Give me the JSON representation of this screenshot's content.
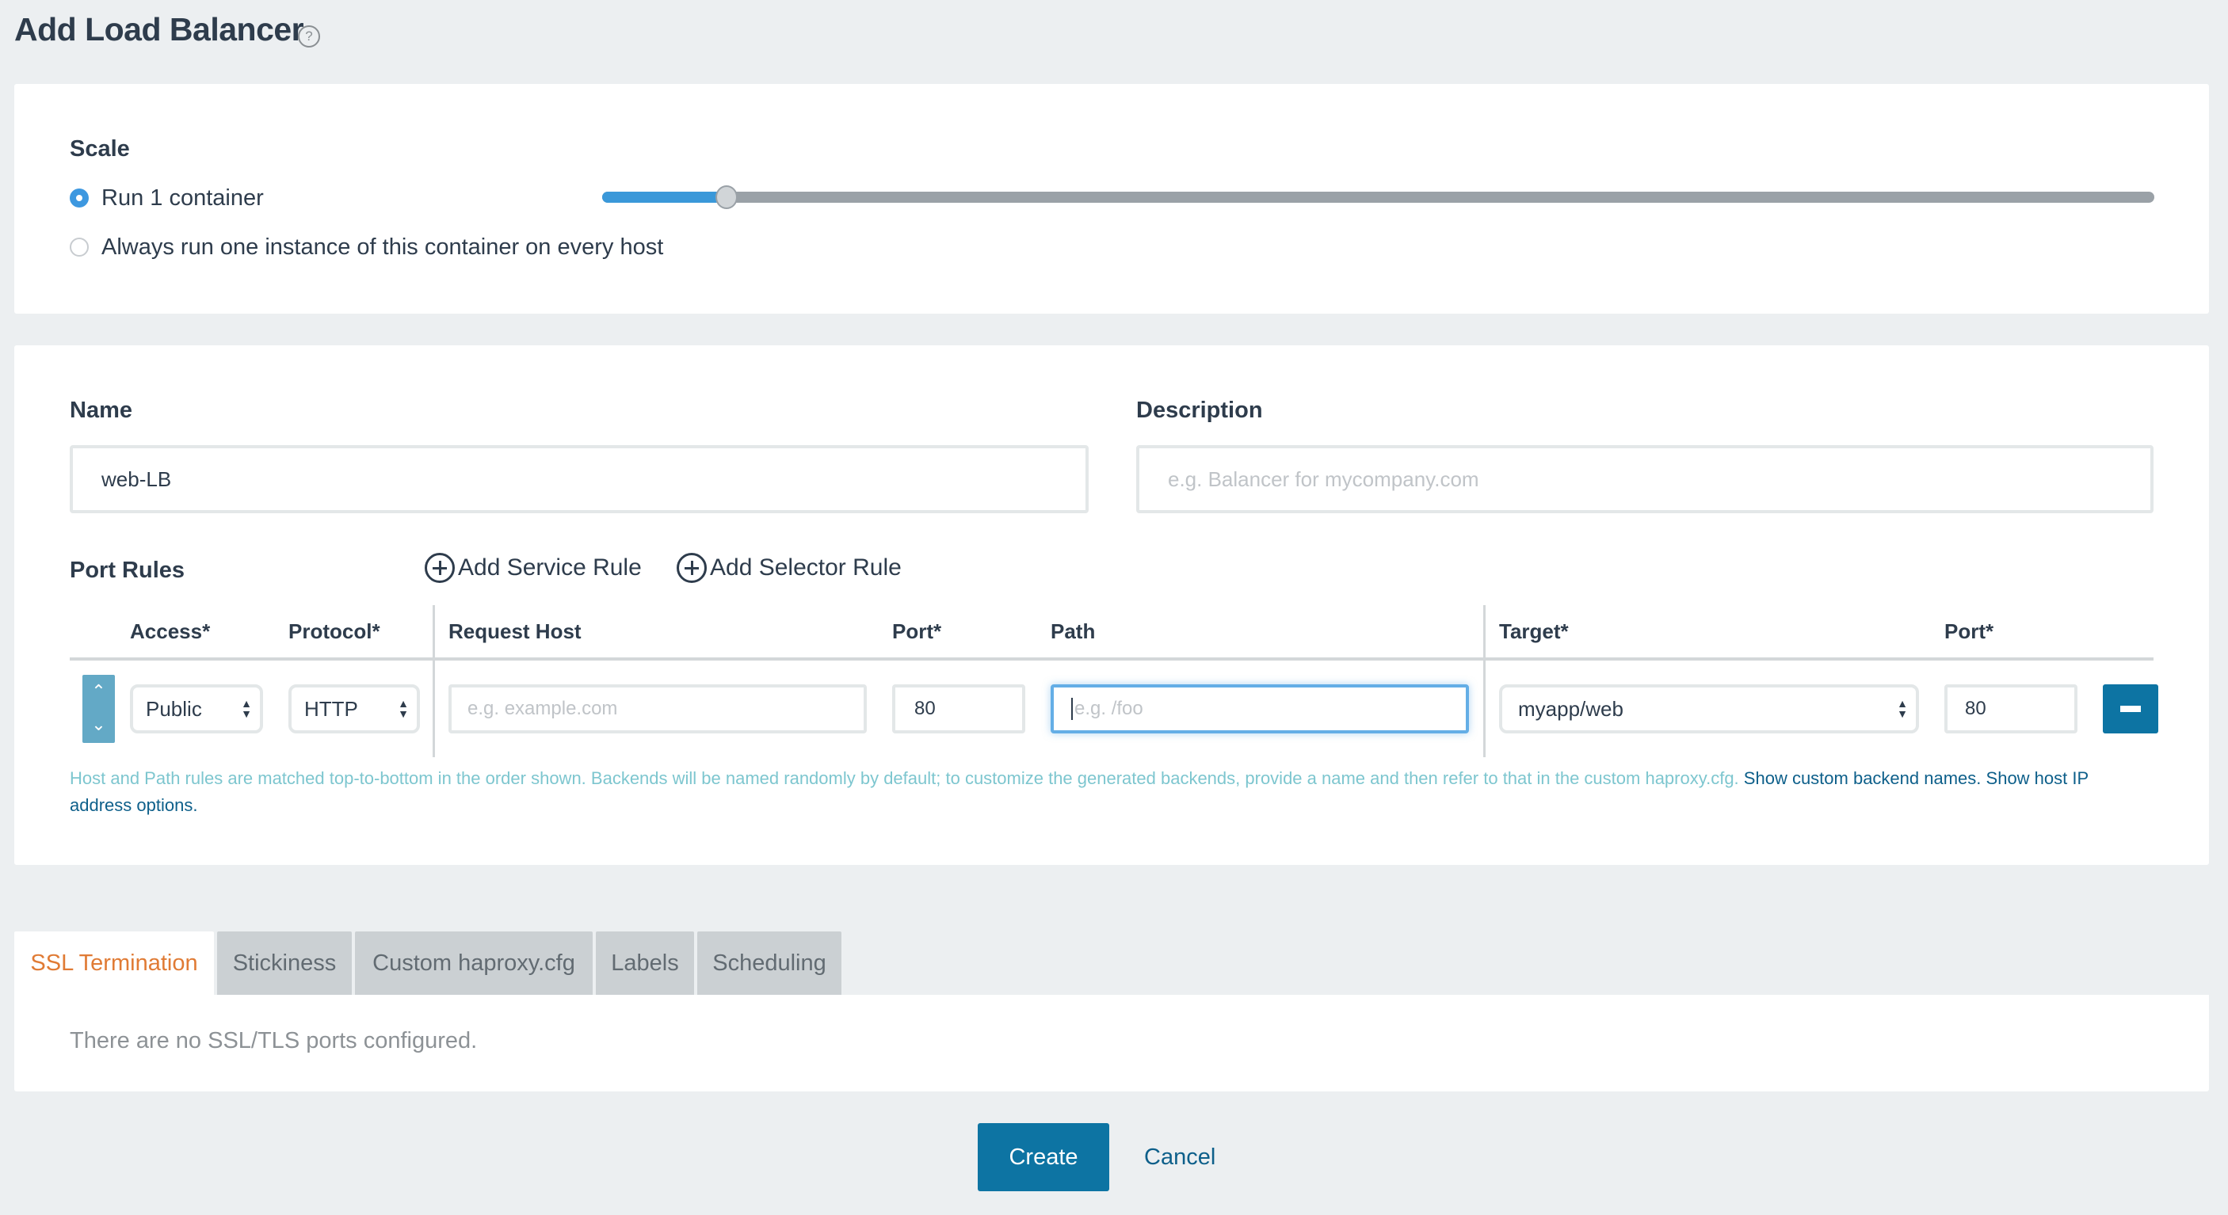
{
  "header": {
    "title": "Add Load Balancer",
    "help_icon": "question-circle-icon"
  },
  "scale": {
    "label": "Scale",
    "options": [
      {
        "label": "Run 1 container",
        "selected": true
      },
      {
        "label": "Always run one instance of this container on every host",
        "selected": false
      }
    ],
    "slider": {
      "value": 1,
      "fill_fraction": 0.08
    }
  },
  "form": {
    "name": {
      "label": "Name",
      "value": "web-LB"
    },
    "description": {
      "label": "Description",
      "value": "",
      "placeholder": "e.g. Balancer for mycompany.com"
    }
  },
  "port_rules": {
    "label": "Port Rules",
    "add_service_rule": "Add Service Rule",
    "add_selector_rule": "Add Selector Rule",
    "columns": [
      "Access*",
      "Protocol*",
      "Request Host",
      "Port*",
      "Path",
      "Target*",
      "Port*"
    ],
    "rows": [
      {
        "access": "Public",
        "protocol": "HTTP",
        "request_host": "",
        "request_host_placeholder": "e.g. example.com",
        "port": "80",
        "path": "",
        "path_placeholder": "e.g. /foo",
        "target": "myapp/web",
        "target_port": "80"
      }
    ],
    "help_text": "Host and Path rules are matched top-to-bottom in the order shown. Backends will be named randomly by default; to customize the generated backends, provide a name and then refer to that in the custom haproxy.cfg.",
    "link_backend_names": "Show custom backend names.",
    "link_host_ip": "Show host IP address options."
  },
  "tabs": {
    "items": [
      {
        "label": "SSL Termination",
        "active": true
      },
      {
        "label": "Stickiness",
        "active": false
      },
      {
        "label": "Custom haproxy.cfg",
        "active": false
      },
      {
        "label": "Labels",
        "active": false
      },
      {
        "label": "Scheduling",
        "active": false
      }
    ],
    "content": "There are no SSL/TLS ports configured."
  },
  "actions": {
    "create": "Create",
    "cancel": "Cancel"
  },
  "colors": {
    "primary": "#0d74a3",
    "accent_orange": "#e07b35",
    "slider_fill": "#3a98d9",
    "help_text": "#7dc6cf"
  }
}
